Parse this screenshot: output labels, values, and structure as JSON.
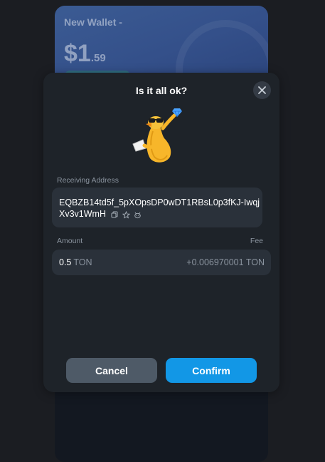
{
  "wallet": {
    "name": "New Wallet -",
    "balance_int": "$1",
    "balance_frac": ".59"
  },
  "modal": {
    "title": "Is it all ok?",
    "receiving_label": "Receiving Address",
    "address": "EQBZB14td5f_5pXOpsDP0wDT1RBsL0p3fKJ-IwqjXv3v1WmH",
    "amount_label": "Amount",
    "fee_label": "Fee",
    "amount_value": "0.5",
    "amount_unit": "TON",
    "fee_value": "+0.006970001 TON",
    "cancel_label": "Cancel",
    "confirm_label": "Confirm"
  },
  "colors": {
    "modal_bg": "#1e2329",
    "field_bg": "#2a313a",
    "accent": "#1297e6",
    "cancel_bg": "#4e5a67"
  },
  "icons": [
    "close-icon",
    "copy-icon",
    "star-icon",
    "bot-icon"
  ]
}
